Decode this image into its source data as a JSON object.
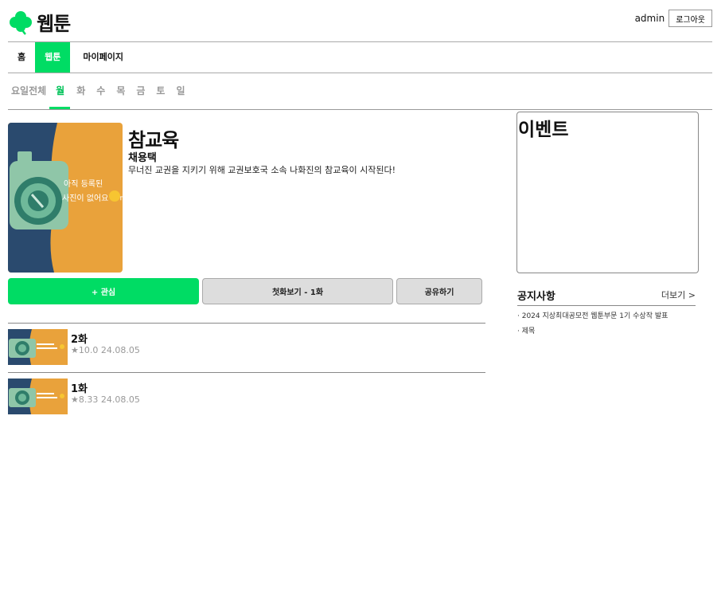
{
  "header": {
    "logo_text": "웹툰",
    "user_name": "admin",
    "logout_label": "로그아웃"
  },
  "nav": [
    "홈",
    "웹툰",
    "마이페이지"
  ],
  "days": [
    "요일전체",
    "월",
    "화",
    "수",
    "목",
    "금",
    "토",
    "일"
  ],
  "webtoon": {
    "title": "참교육",
    "author": "채용택",
    "description": "무너진 교권을 지키기 위해 교권보호국 소속 나화진의 참교육이 시작된다!",
    "thumb_text": "아직 등록된 사진이 없어요 ㅠㅠ"
  },
  "buttons": {
    "favorite": "+ 관심",
    "first_episode": "첫화보기 - 1화",
    "share": "공유하기"
  },
  "episodes": [
    {
      "title": "2화",
      "rating": "★10.0",
      "date": "24.08.05"
    },
    {
      "title": "1화",
      "rating": "★8.33",
      "date": "24.08.05"
    }
  ],
  "event": {
    "title": "이벤트"
  },
  "notice": {
    "title": "공지사항",
    "more": "더보기 >",
    "items": [
      "· 2024 지상최대공모전 웹툰부문 1기 수상작 발표",
      "· 제목"
    ]
  },
  "colors": {
    "accent": "#00dc64",
    "thumb_orange": "#e9a23b",
    "thumb_navy": "#2a4a6e"
  }
}
